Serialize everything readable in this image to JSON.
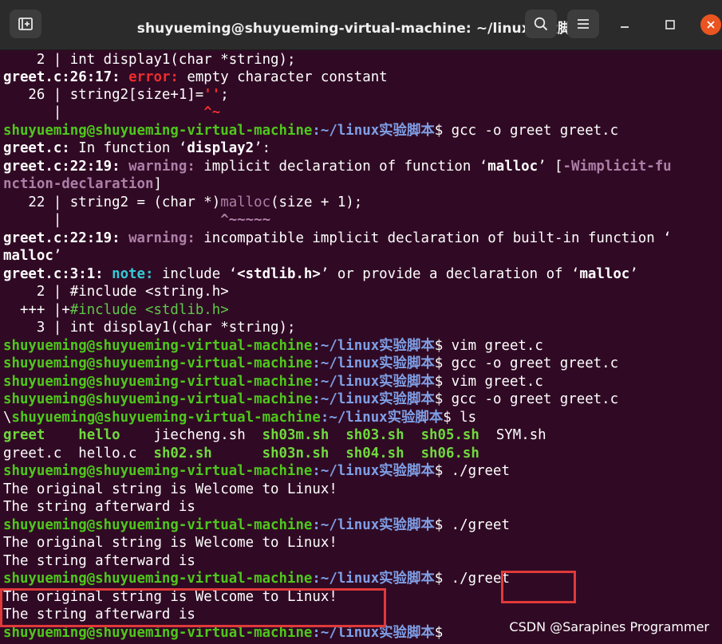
{
  "window": {
    "title": "shuyueming@shuyueming-virtual-machine: ~/linux实验脚本",
    "new_tab_icon": "new-tab-icon",
    "search_icon": "search-icon",
    "menu_icon": "hamburger-menu-icon"
  },
  "terminal": {
    "lines": [
      [
        "    2 | int display1(char *string);"
      ],
      [
        "greet.c:26:17:",
        " error:",
        " empty character constant"
      ],
      [
        "   26 | string2[size+1]=",
        "''",
        ";"
      ],
      [
        "      |                 ",
        "^~"
      ],
      [
        "shuyueming@shuyueming-virtual-machine",
        ":~/linux实验脚本",
        "$ gcc -o greet greet.c"
      ],
      [
        "greet.c:",
        " In function ‘",
        "display2",
        "’:"
      ],
      [
        "greet.c:22:19:",
        " warning:",
        " implicit declaration of function ‘",
        "malloc",
        "’ [",
        "-Wimplicit-fu"
      ],
      [
        "nction-declaration",
        "]"
      ],
      [
        "   22 | string2 = (char *)",
        "malloc",
        "(size + 1);"
      ],
      [
        "      |                   ",
        "^~~~~~"
      ],
      [
        "greet.c:22:19:",
        " warning:",
        " incompatible implicit declaration of built-in function ‘"
      ],
      [
        "malloc",
        "’"
      ],
      [
        "greet.c:3:1:",
        " note:",
        " include ‘",
        "<stdlib.h>",
        "’ or provide a declaration of ‘",
        "malloc",
        "’"
      ],
      [
        "    2 | #include <string.h>"
      ],
      [
        "  +++ |+",
        "#include <stdlib.h>"
      ],
      [
        "    3 | int display1(char *string);"
      ],
      [
        "shuyueming@shuyueming-virtual-machine",
        ":~/linux实验脚本",
        "$ vim greet.c"
      ],
      [
        "shuyueming@shuyueming-virtual-machine",
        ":~/linux实验脚本",
        "$ gcc -o greet greet.c"
      ],
      [
        "shuyueming@shuyueming-virtual-machine",
        ":~/linux实验脚本",
        "$ vim greet.c"
      ],
      [
        "shuyueming@shuyueming-virtual-machine",
        ":~/linux实验脚本",
        "$ gcc -o greet greet.c"
      ],
      [
        "\\",
        "shuyueming@shuyueming-virtual-machine",
        ":~/linux实验脚本",
        "$ ls"
      ],
      [
        "greet",
        "    ",
        "hello",
        "    jiecheng.sh  ",
        "sh03m.sh",
        "  ",
        "sh03.sh",
        "  ",
        "sh05.sh",
        "  SYM.sh"
      ],
      [
        "greet.c  hello.c  ",
        "sh02.sh",
        "      ",
        "sh03n.sh",
        "  ",
        "sh04.sh",
        "  ",
        "sh06.sh"
      ],
      [
        "shuyueming@shuyueming-virtual-machine",
        ":~/linux实验脚本",
        "$ ./greet"
      ],
      [
        "The original string is Welcome to Linux!"
      ],
      [
        "The string afterward is"
      ],
      [
        "shuyueming@shuyueming-virtual-machine",
        ":~/linux实验脚本",
        "$ ./greet"
      ],
      [
        "The original string is Welcome to Linux!"
      ],
      [
        "The string afterward is"
      ],
      [
        "shuyueming@shuyueming-virtual-machine",
        ":~/linux实验脚本",
        "$ ./greet"
      ],
      [
        "The original string is Welcome to Linux!"
      ],
      [
        "The string afterward is"
      ],
      [
        "shuyueming@shuyueming-virtual-machine",
        ":~/linux实验脚本",
        "$ "
      ]
    ]
  },
  "watermark": "CSDN @Sarapines Programmer"
}
